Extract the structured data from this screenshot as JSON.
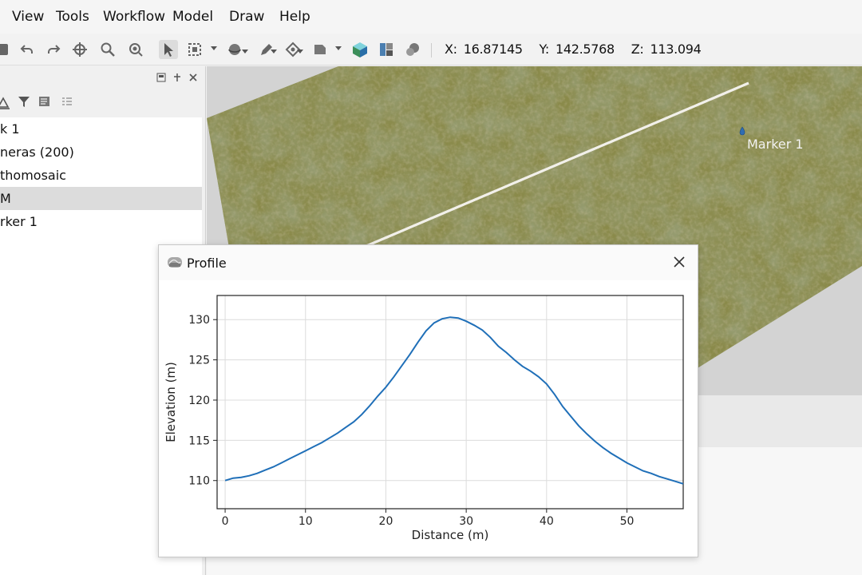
{
  "menu": {
    "items": [
      {
        "label": "View"
      },
      {
        "label": "Tools"
      },
      {
        "label": "Workflow"
      },
      {
        "label": "Model"
      },
      {
        "label": "Draw"
      },
      {
        "label": "Help"
      }
    ]
  },
  "toolbar": {
    "coords": {
      "x_label": "X:",
      "x_value": "16.87145",
      "y_label": "Y:",
      "y_value": "142.5768",
      "z_label": "Z:",
      "z_value": "113.094"
    },
    "icons": [
      "save-icon",
      "undo-icon",
      "redo-icon",
      "navigate-icon",
      "zoom-icon",
      "target-icon",
      "select-icon",
      "rectangle-select-icon",
      "rotate-object-icon",
      "draw-icon",
      "marker-icon",
      "shape-icon",
      "tiled-model-icon",
      "texture-icon",
      "globe-icon"
    ]
  },
  "panel": {
    "tree": [
      {
        "label": "k 1"
      },
      {
        "label": "neras (200)"
      },
      {
        "label": "thomosaic"
      },
      {
        "label": "M",
        "selected": true
      },
      {
        "label": "rker 1"
      }
    ]
  },
  "viewport": {
    "marker_label": "Marker 1"
  },
  "dialog": {
    "title": "Profile"
  },
  "chart_data": {
    "type": "line",
    "title": "",
    "xlabel": "Distance (m)",
    "ylabel": "Elevation (m)",
    "xlim": [
      -1,
      57
    ],
    "ylim": [
      106.5,
      133
    ],
    "xticks": [
      0,
      10,
      20,
      30,
      40,
      50
    ],
    "yticks": [
      110,
      115,
      120,
      125,
      130
    ],
    "grid": true,
    "line_color": "#1f6fb8",
    "series": [
      {
        "x": [
          0,
          1,
          2,
          3,
          4,
          5,
          6,
          7,
          8,
          9,
          10,
          11,
          12,
          13,
          14,
          15,
          16,
          17,
          18,
          19,
          20,
          21,
          22,
          23,
          24,
          25,
          26,
          27,
          28,
          29,
          30,
          31,
          32,
          33,
          34,
          35,
          36,
          37,
          38,
          39,
          40,
          41,
          42,
          43,
          44,
          45,
          46,
          47,
          48,
          49,
          50,
          51,
          52,
          53,
          54,
          55,
          56,
          57
        ],
        "y": [
          110.0,
          110.3,
          110.4,
          110.6,
          110.9,
          111.3,
          111.7,
          112.2,
          112.7,
          113.2,
          113.7,
          114.2,
          114.7,
          115.3,
          115.9,
          116.6,
          117.3,
          118.2,
          119.3,
          120.5,
          121.6,
          122.9,
          124.3,
          125.7,
          127.2,
          128.6,
          129.6,
          130.1,
          130.3,
          130.2,
          129.8,
          129.3,
          128.7,
          127.8,
          126.7,
          125.9,
          125.0,
          124.2,
          123.6,
          122.9,
          122.0,
          120.7,
          119.2,
          118.0,
          116.8,
          115.8,
          114.9,
          114.1,
          113.4,
          112.8,
          112.2,
          111.7,
          111.2,
          110.9,
          110.5,
          110.2,
          109.9,
          109.6
        ]
      }
    ]
  }
}
